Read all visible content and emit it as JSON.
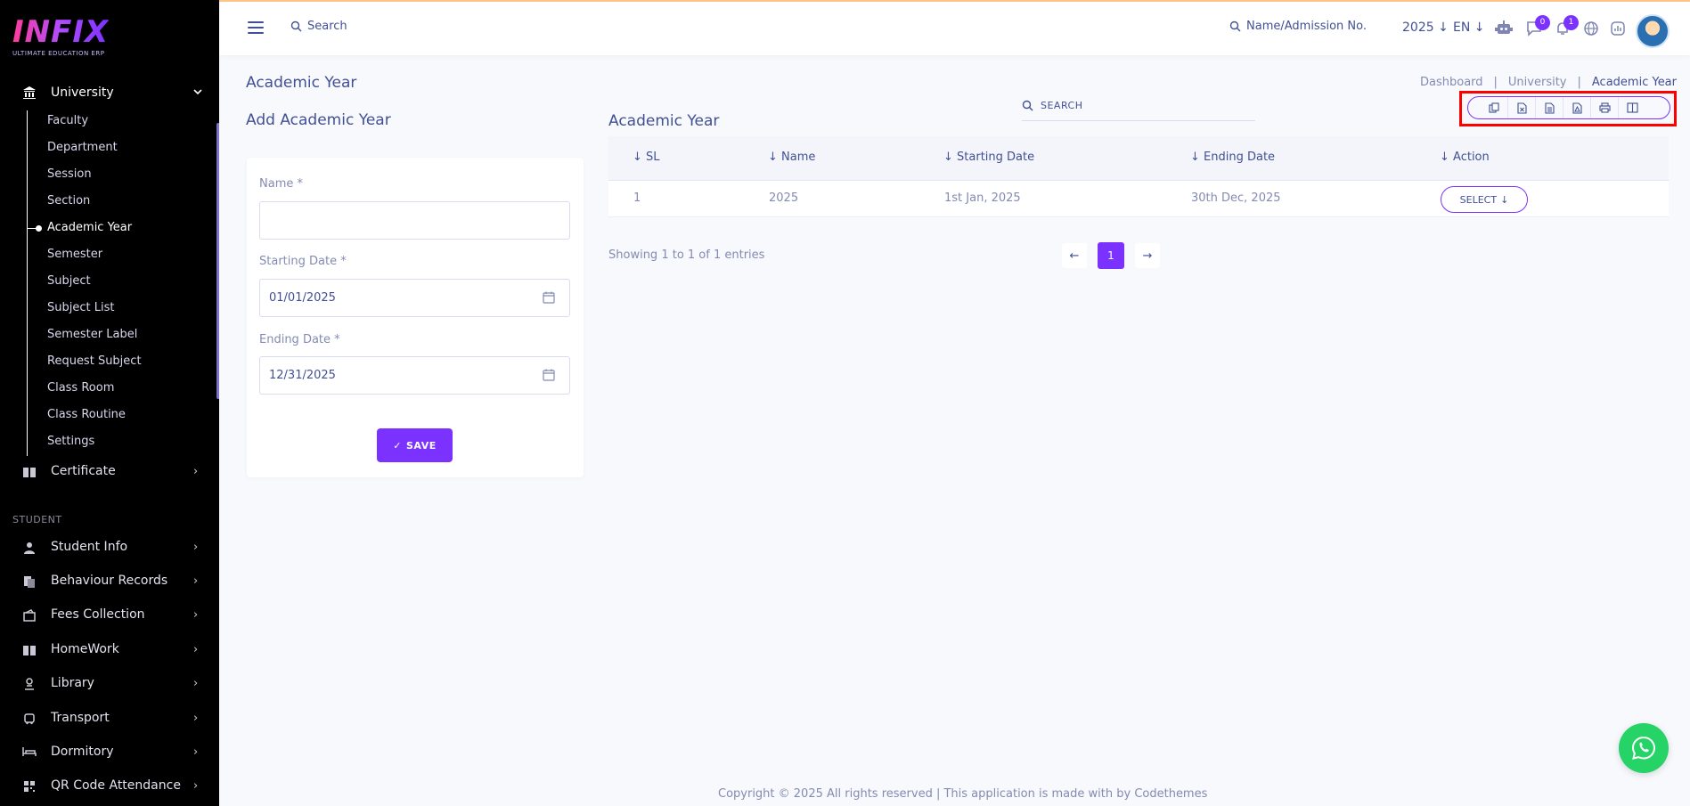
{
  "brand": {
    "logo": "INFIX",
    "tagline": "ULTIMATE EDUCATION ERP"
  },
  "sidebar": {
    "university": {
      "label": "University",
      "icon": "bank-icon"
    },
    "submenu": [
      {
        "label": "Faculty",
        "active": false
      },
      {
        "label": "Department",
        "active": false
      },
      {
        "label": "Session",
        "active": false
      },
      {
        "label": "Section",
        "active": false
      },
      {
        "label": "Academic Year",
        "active": true
      },
      {
        "label": "Semester",
        "active": false
      },
      {
        "label": "Subject",
        "active": false
      },
      {
        "label": "Subject List",
        "active": false
      },
      {
        "label": "Semester Label",
        "active": false
      },
      {
        "label": "Request Subject",
        "active": false
      },
      {
        "label": "Class Room",
        "active": false
      },
      {
        "label": "Class Routine",
        "active": false
      },
      {
        "label": "Settings",
        "active": false
      }
    ],
    "certificate": {
      "label": "Certificate",
      "icon": "book-icon"
    },
    "section_label": "STUDENT",
    "items": [
      {
        "label": "Student Info",
        "icon": "user-icon"
      },
      {
        "label": "Behaviour Records",
        "icon": "records-icon"
      },
      {
        "label": "Fees Collection",
        "icon": "wallet-icon"
      },
      {
        "label": "HomeWork",
        "icon": "book-icon"
      },
      {
        "label": "Library",
        "icon": "library-icon"
      },
      {
        "label": "Transport",
        "icon": "bus-icon"
      },
      {
        "label": "Dormitory",
        "icon": "bed-icon"
      },
      {
        "label": "QR Code Attendance",
        "icon": "qr-icon"
      }
    ]
  },
  "header": {
    "search_placeholder": "Search",
    "student_search_placeholder": "Name/Admission No.",
    "year": "2025",
    "language": "EN",
    "chat_badge": "0",
    "notification_badge": "1"
  },
  "page": {
    "title": "Academic Year",
    "breadcrumb": [
      "Dashboard",
      "University",
      "Academic Year"
    ]
  },
  "form": {
    "title": "Add Academic Year",
    "name_label": "Name *",
    "name_value": "",
    "start_label": "Starting Date *",
    "start_value": "01/01/2025",
    "end_label": "Ending Date *",
    "end_value": "12/31/2025",
    "save_label": "SAVE"
  },
  "table": {
    "title": "Academic Year",
    "search_label": "SEARCH",
    "columns": [
      "SL",
      "Name",
      "Starting Date",
      "Ending Date",
      "Action"
    ],
    "rows": [
      {
        "sl": "1",
        "name": "2025",
        "start": "1st Jan, 2025",
        "end": "30th Dec, 2025",
        "action": "SELECT"
      }
    ],
    "export_buttons": [
      "copy-icon",
      "excel-icon",
      "csv-icon",
      "pdf-icon",
      "print-icon",
      "columns-icon"
    ],
    "showing": "Showing 1 to 1 of 1 entries",
    "current_page": "1"
  },
  "footer": {
    "text": "Copyright © 2025 All rights reserved | This application is made with by Codethemes"
  },
  "colors": {
    "accent": "#7c32ff",
    "text": "#415094",
    "muted": "#828bb2",
    "highlight": "#ff0000",
    "whatsapp": "#25d366"
  }
}
